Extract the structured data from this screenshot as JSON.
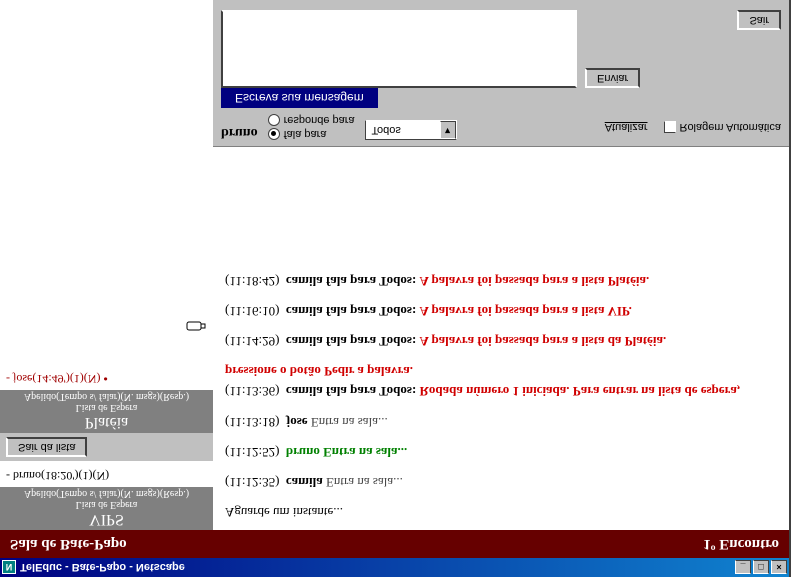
{
  "window": {
    "title": "TelEduc - Bate-Papo - Netscape",
    "icon_glyph": "N",
    "min": "_",
    "max": "□",
    "close": "×"
  },
  "header": {
    "left": "Sala de Bate-Papo",
    "right": "1º Encontro"
  },
  "sidebar": {
    "vips": {
      "title": "VIPS",
      "sub1": "Lista de Espera",
      "sub2": "Apelido(Tempo s/ falar)(N. msgs)(Resp.)",
      "items": [
        "- bruno(18:20')(1)(N)"
      ],
      "leave_btn": "Sair da lista"
    },
    "plateia": {
      "title": "Platéia",
      "sub1": "Lista de Espera",
      "sub2": "Apelido(Tempo s/ falar)(N. msgs)(Resp.)",
      "items": [
        "- jose(14:49')(1)(N)"
      ]
    }
  },
  "chat": {
    "wait": "Aguarde um instante...",
    "lines": [
      {
        "time": "(11:12:35)",
        "user": "camila",
        "action": " Entra na sala...",
        "cls": "gray"
      },
      {
        "time": "(11:12:52)",
        "user": "bruno",
        "action": " Entra na sala...",
        "cls": "green"
      },
      {
        "time": "(11:13:18)",
        "user": "jose",
        "action": " Entra na sala...",
        "cls": "gray"
      }
    ],
    "msg1": {
      "time": "(11:13:36)",
      "prefix": "camila fala para Todos:",
      "text": "Rodada número 1 iniciada. Para entrar na lista de espera, pressione o botão Pedir a palavra."
    },
    "msg2": {
      "time": "(11:14:29)",
      "prefix": "camila fala para Todos:",
      "text": "A palavra foi passada para a lista da Platéia."
    },
    "msg3": {
      "time": "(11:16:10)",
      "prefix": "camila fala para Todos:",
      "text": "A palavra foi passada para a lista VIP."
    },
    "msg4": {
      "time": "(11:18:42)",
      "prefix": "camila fala para Todos:",
      "text": "A palavra foi passada para a lista Platéia."
    }
  },
  "compose": {
    "user": "bruno",
    "radio1": "fala para",
    "radio2": "responde para",
    "target": "Todos",
    "refresh": "Atualizar",
    "autoscroll": "Rolagem Automática",
    "label": "Escreva sua mensagem",
    "send": "Enviar",
    "exit": "Sair"
  }
}
